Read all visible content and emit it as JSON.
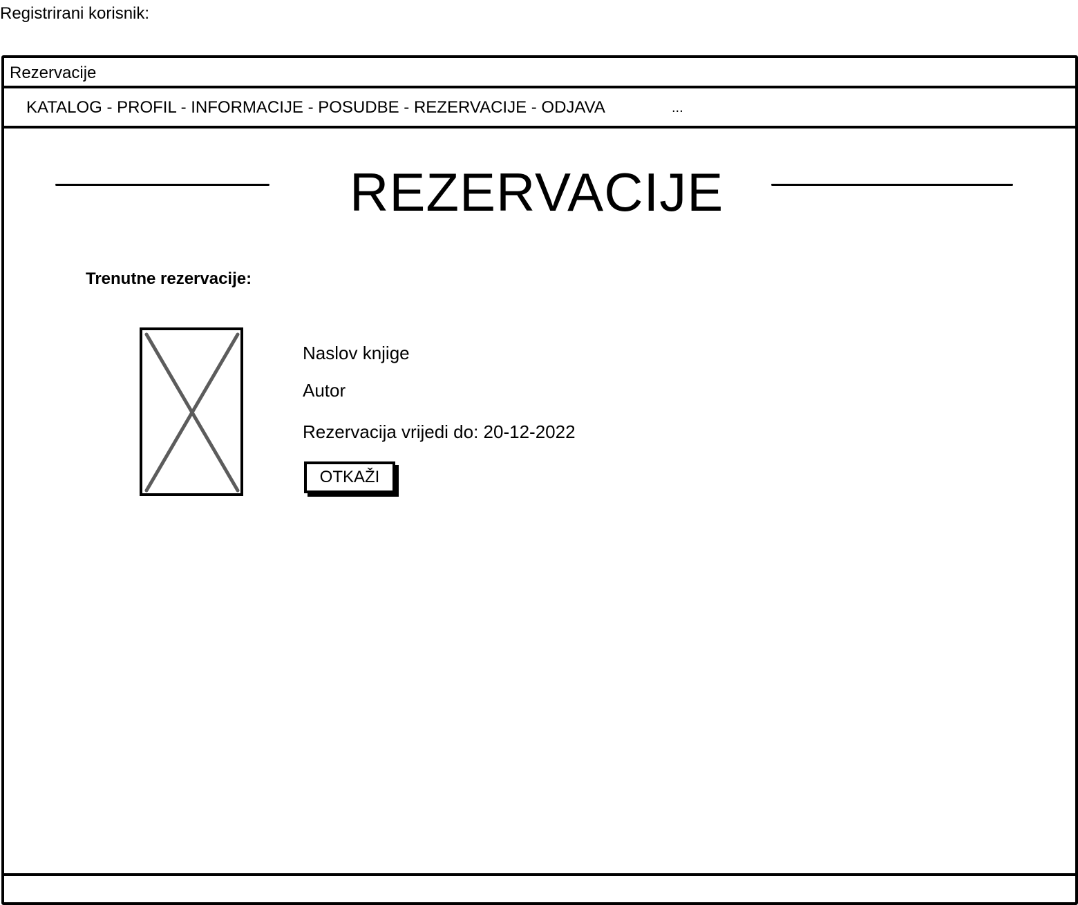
{
  "caption": "Registrirani korisnik:",
  "window": {
    "title": "Rezervacije"
  },
  "nav": {
    "links": "KATALOG - PROFIL - INFORMACIJE - POSUDBE - REZERVACIJE - ODJAVA",
    "more": "..."
  },
  "page": {
    "title": "REZERVACIJE",
    "section_label": "Trenutne rezervacije:"
  },
  "reservation": {
    "cover_icon": "image-placeholder-icon",
    "book_title": "Naslov knjige",
    "author": "Autor",
    "valid_until": "Rezervacija vrijedi do: 20-12-2022",
    "cancel_label": "OTKAŽI"
  }
}
